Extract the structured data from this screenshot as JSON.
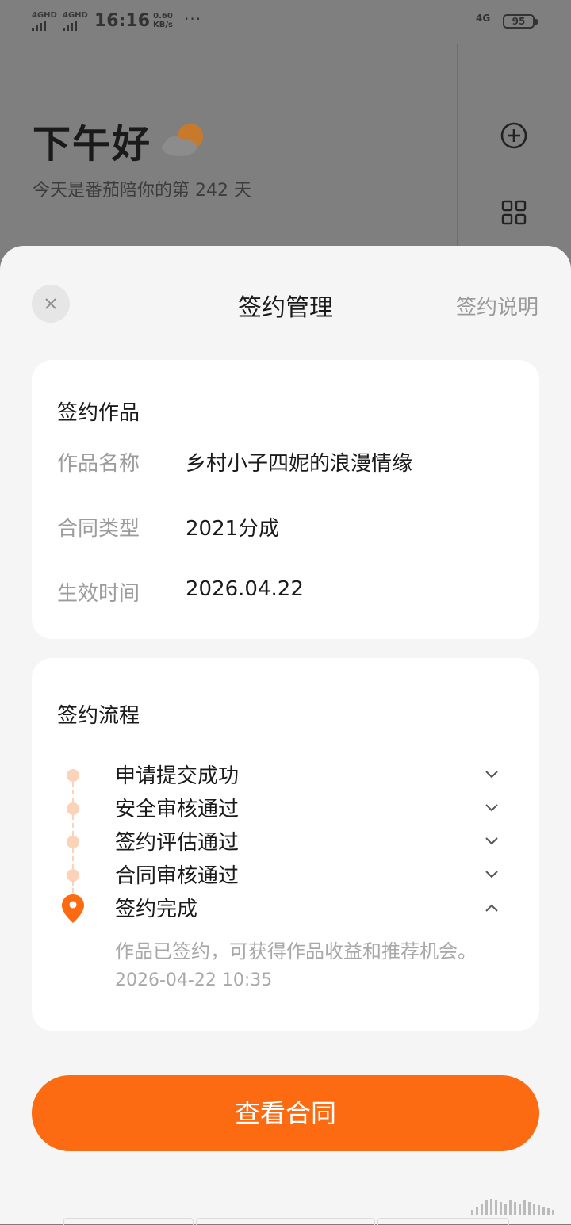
{
  "status_bar": {
    "signal1": "4GHD",
    "signal2": "4GHD",
    "time": "16:16",
    "speed_value": "0.60",
    "speed_unit": "KB/s",
    "more": "···",
    "net": "4G",
    "battery": "95"
  },
  "background": {
    "greeting": "下午好",
    "weather_icon": "partly-cloudy-icon",
    "subtitle": "今天是番茄陪你的第 242 天",
    "plus_icon": "plus-circle-icon",
    "grid_icon": "grid-icon"
  },
  "sheet": {
    "title": "签约管理",
    "help_link": "签约说明",
    "close_icon": "close-icon"
  },
  "work_card": {
    "heading": "签约作品",
    "rows": [
      {
        "label": "作品名称",
        "value": "乡村小子四妮的浪漫情缘"
      },
      {
        "label": "合同类型",
        "value": "2021分成"
      },
      {
        "label": "生效时间",
        "value": "2026.04.22"
      }
    ]
  },
  "process_card": {
    "heading": "签约流程",
    "steps": [
      {
        "label": "申请提交成功",
        "expanded": false
      },
      {
        "label": "安全审核通过",
        "expanded": false
      },
      {
        "label": "签约评估通过",
        "expanded": false
      },
      {
        "label": "合同审核通过",
        "expanded": false
      },
      {
        "label": "签约完成",
        "expanded": true,
        "current": true
      }
    ],
    "current_desc": "作品已签约，可获得作品收益和推荐机会。",
    "current_time": "2026-04-22 10:35"
  },
  "cta": {
    "label": "查看合同"
  },
  "colors": {
    "accent": "#fc6a12",
    "step_dot": "#fcd3b8",
    "overlay_bg": "#7f7f7f"
  }
}
